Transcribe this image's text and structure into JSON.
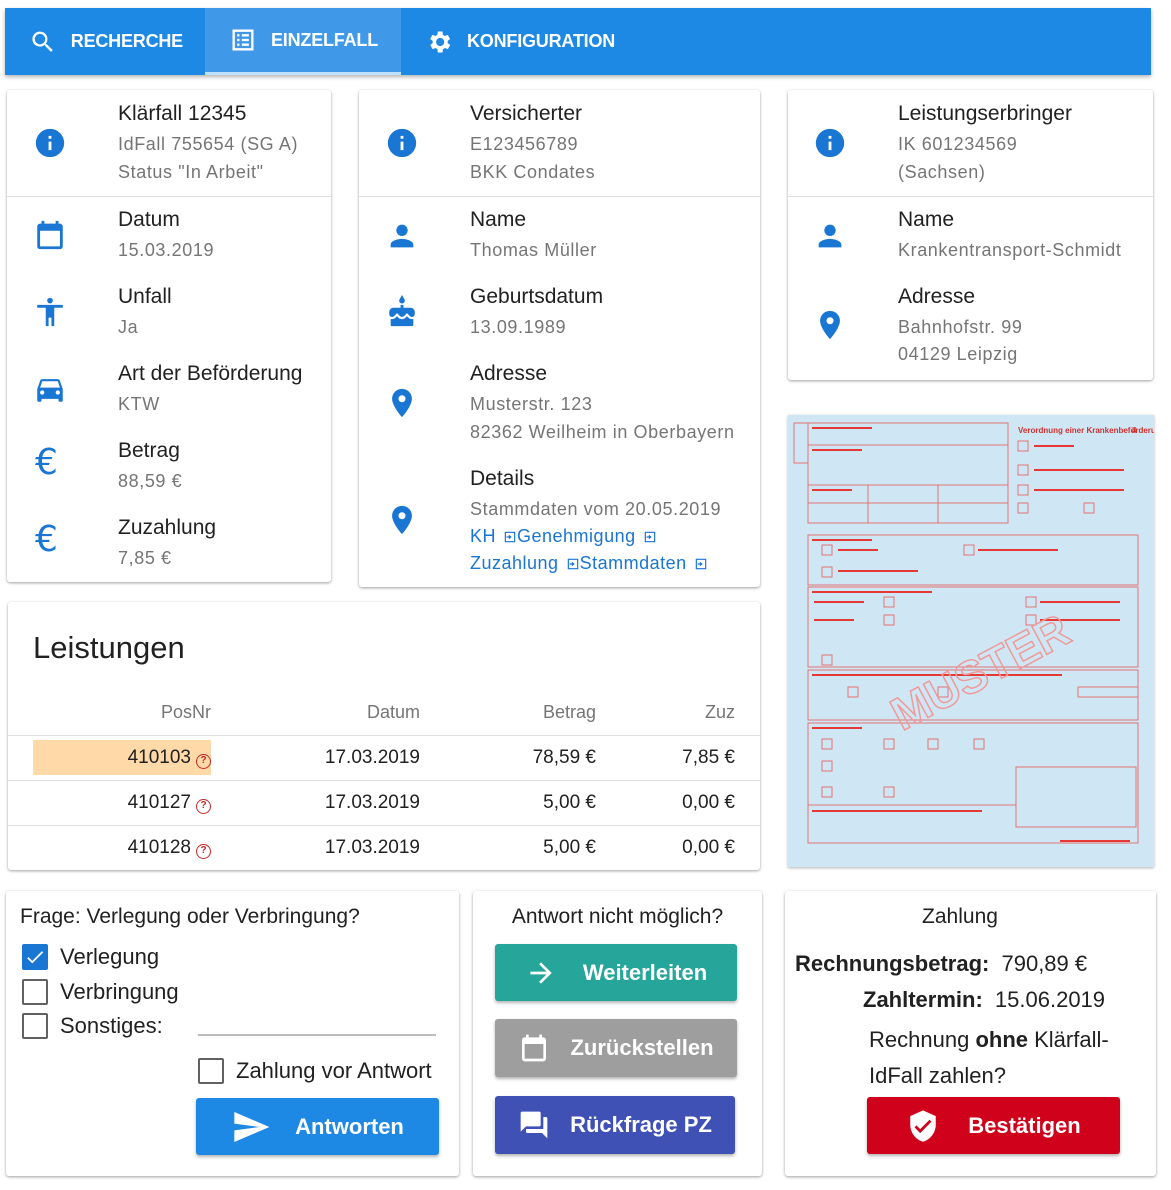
{
  "nav": {
    "tabs": [
      {
        "label": "RECHERCHE",
        "icon": "search-icon"
      },
      {
        "label": "EINZELFALL",
        "icon": "list-icon"
      },
      {
        "label": "KONFIGURATION",
        "icon": "gear-icon"
      }
    ],
    "active_tab": "EINZELFALL"
  },
  "case": {
    "title": "Klärfall 12345",
    "idfall": "IdFall 755654 (SG A)",
    "status": "Status \"In Arbeit\"",
    "datum_label": "Datum",
    "datum": "15.03.2019",
    "unfall_label": "Unfall",
    "unfall": "Ja",
    "art_label": "Art der Beförderung",
    "art": "KTW",
    "betrag_label": "Betrag",
    "betrag": "88,59 €",
    "zuzahlung_label": "Zuzahlung",
    "zuzahlung": "7,85 €"
  },
  "insured": {
    "title": "Versicherter",
    "number": "E123456789",
    "kasse": "BKK Condates",
    "name_label": "Name",
    "name": "Thomas Müller",
    "birth_label": "Geburtsdatum",
    "birth": "13.09.1989",
    "address_label": "Adresse",
    "street": "Musterstr. 123",
    "city": "82362 Weilheim in Oberbayern",
    "details_label": "Details",
    "details_sub": "Stammdaten vom 20.05.2019",
    "links": [
      "KH",
      "Genehmigung",
      "Zuzahlung",
      "Stammdaten"
    ]
  },
  "provider": {
    "title": "Leistungserbringer",
    "ik": "IK 601234569",
    "region": "(Sachsen)",
    "name_label": "Name",
    "name": "Krankentransport-Schmidt",
    "address_label": "Adresse",
    "street": "Bahnhofstr. 99",
    "city": "04129 Leipzig"
  },
  "leistungen": {
    "title": "Leistungen",
    "columns": [
      "PosNr",
      "Datum",
      "Betrag",
      "Zuz"
    ],
    "rows": [
      {
        "posnr": "410103",
        "datum": "17.03.2019",
        "betrag": "78,59 €",
        "zuz": "7,85 €",
        "highlight": true
      },
      {
        "posnr": "410127",
        "datum": "17.03.2019",
        "betrag": "5,00 €",
        "zuz": "0,00 €",
        "highlight": false
      },
      {
        "posnr": "410128",
        "datum": "17.03.2019",
        "betrag": "5,00 €",
        "zuz": "0,00 €",
        "highlight": false
      }
    ]
  },
  "form_preview": {
    "heading": "Verordnung einer Krankenbeförderung",
    "number": "4",
    "watermark": "MUSTER"
  },
  "question": {
    "title": "Frage: Verlegung oder Verbringung?",
    "options": [
      {
        "label": "Verlegung",
        "checked": true
      },
      {
        "label": "Verbringung",
        "checked": false
      },
      {
        "label": "Sonstiges:",
        "checked": false
      }
    ],
    "payment_label": "Zahlung vor Antwort",
    "payment_checked": false,
    "answer_button": "Antworten"
  },
  "actions": {
    "title": "Antwort nicht möglich?",
    "forward_button": "Weiterleiten",
    "defer_button": "Zurückstellen",
    "query_button": "Rückfrage PZ"
  },
  "payment": {
    "title": "Zahlung",
    "amount_label": "Rechnungsbetrag:",
    "amount": "790,89 €",
    "due_label": "Zahltermin:",
    "due": "15.06.2019",
    "question_pre": "Rechnung",
    "question_bold": "ohne",
    "question_post1": "Klärfall-",
    "question_post2": "IdFall zahlen?",
    "confirm_button": "Bestätigen"
  },
  "colors": {
    "primary": "#1e88e5",
    "icon_blue": "#1976d2",
    "teal": "#26a69a",
    "grey_button": "#9e9e9e",
    "indigo": "#3f51b5",
    "red": "#d0021b",
    "highlight": "#ffd9a8"
  }
}
